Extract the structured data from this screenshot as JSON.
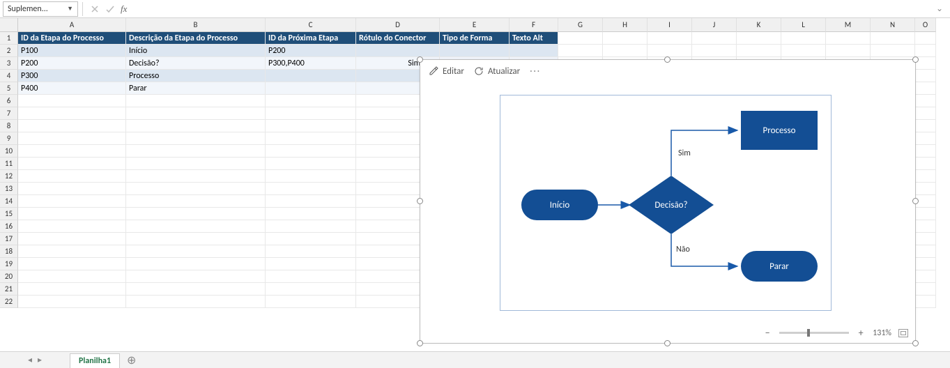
{
  "name_box": {
    "value": "Suplemen..."
  },
  "columns": [
    {
      "letter": "A",
      "wclass": "w-a"
    },
    {
      "letter": "B",
      "wclass": "w-b"
    },
    {
      "letter": "C",
      "wclass": "w-c"
    },
    {
      "letter": "D",
      "wclass": "w-d"
    },
    {
      "letter": "E",
      "wclass": "w-e"
    },
    {
      "letter": "F",
      "wclass": "w-f"
    },
    {
      "letter": "G",
      "wclass": "w-g"
    },
    {
      "letter": "H",
      "wclass": "w-h"
    },
    {
      "letter": "I",
      "wclass": "w-i"
    },
    {
      "letter": "J",
      "wclass": "w-j"
    },
    {
      "letter": "K",
      "wclass": "w-k"
    },
    {
      "letter": "L",
      "wclass": "w-l"
    },
    {
      "letter": "M",
      "wclass": "w-m"
    },
    {
      "letter": "N",
      "wclass": "w-n"
    },
    {
      "letter": "O",
      "wclass": "w-o"
    }
  ],
  "table": {
    "headers": [
      "ID da Etapa do Processo",
      "Descrição da Etapa do Processo",
      "ID da Próxima Etapa",
      "Rótulo do Conector",
      "Tipo de Forma",
      "Texto Alt"
    ],
    "rows": [
      {
        "a": "P100",
        "b": "Início",
        "c": "P200",
        "d": "",
        "e": "",
        "f": ""
      },
      {
        "a": "P200",
        "b": "Decisão?",
        "c": "P300,P400",
        "d": "Sim,Não",
        "e": "",
        "f": ""
      },
      {
        "a": "P300",
        "b": "Processo",
        "c": "",
        "d": "",
        "e": "",
        "f": ""
      },
      {
        "a": "P400",
        "b": "Parar",
        "c": "",
        "d": "",
        "e": "",
        "f": ""
      }
    ]
  },
  "row_numbers": [
    "1",
    "2",
    "3",
    "4",
    "5",
    "6",
    "7",
    "8",
    "9",
    "10",
    "11",
    "12",
    "13",
    "14",
    "15",
    "16",
    "17",
    "18",
    "19",
    "20",
    "21",
    "22"
  ],
  "visio": {
    "toolbar": {
      "edit": "Editar",
      "refresh": "Atualizar"
    },
    "shapes": {
      "start": "Início",
      "decision": "Decisão?",
      "process": "Processo",
      "stop": "Parar",
      "yes_label": "Sim",
      "no_label": "Não"
    },
    "zoom": {
      "percent": "131%"
    }
  },
  "sheet": {
    "tab": "Planilha1"
  },
  "chart_data": {
    "type": "flowchart",
    "nodes": [
      {
        "id": "P100",
        "label": "Início",
        "shape": "terminator"
      },
      {
        "id": "P200",
        "label": "Decisão?",
        "shape": "decision"
      },
      {
        "id": "P300",
        "label": "Processo",
        "shape": "process"
      },
      {
        "id": "P400",
        "label": "Parar",
        "shape": "terminator"
      }
    ],
    "edges": [
      {
        "from": "P100",
        "to": "P200",
        "label": ""
      },
      {
        "from": "P200",
        "to": "P300",
        "label": "Sim"
      },
      {
        "from": "P200",
        "to": "P400",
        "label": "Não"
      }
    ]
  }
}
